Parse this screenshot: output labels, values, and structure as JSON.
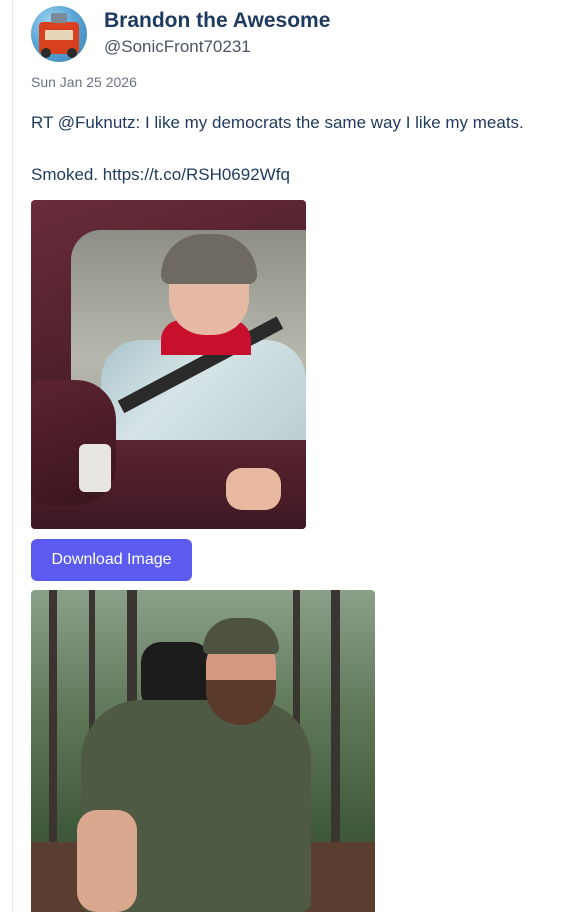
{
  "author": {
    "display_name": "Brandon the Awesome",
    "handle": "@SonicFront70231"
  },
  "post": {
    "date": "Sun Jan 25 2026",
    "text": "RT @Fuknutz: I like my democrats the same way I like my meats.\n\nSmoked. https://t.co/RSH0692Wfq"
  },
  "actions": {
    "download_label": "Download Image"
  },
  "colors": {
    "name": "#1e3a5f",
    "text": "#1e3a5f",
    "muted": "#6b7280",
    "button": "#5b5bf2"
  }
}
